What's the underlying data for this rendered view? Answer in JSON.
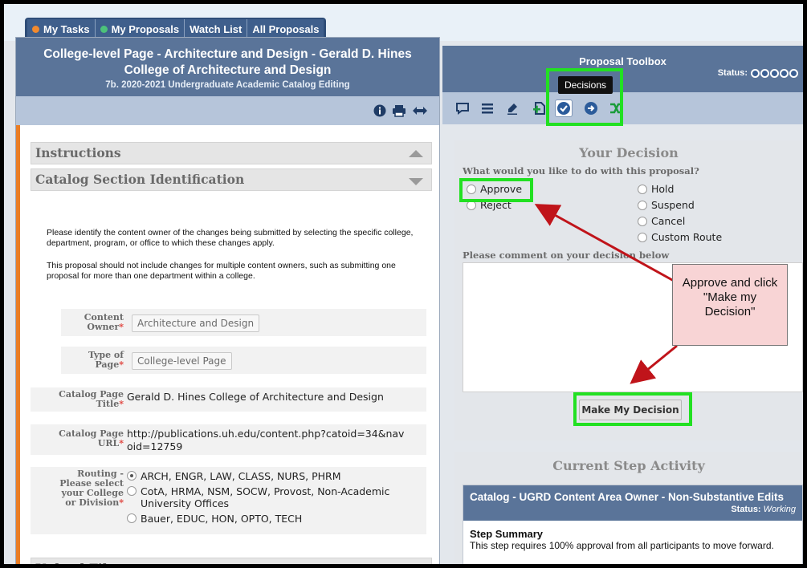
{
  "tabs": [
    {
      "label": "My Tasks",
      "dot_color": "#f28a2e"
    },
    {
      "label": "My Proposals",
      "dot_color": "#4cc17a"
    },
    {
      "label": "Watch List"
    },
    {
      "label": "All Proposals"
    }
  ],
  "proposal": {
    "title": "College-level Page - Architecture and Design - Gerald D. Hines College of Architecture and Design",
    "subtitle": "7b. 2020-2021 Undergraduate Academic Catalog Editing",
    "header_icons": [
      "info-icon",
      "print-icon",
      "expand-horizontal-icon"
    ]
  },
  "sections": {
    "instructions": "Instructions",
    "catalog_section": "Catalog Section Identification",
    "upload_file": "Upload File"
  },
  "instructions_text": {
    "p1": "Please identify the content owner of the changes being submitted by selecting the specific college, department, program, or office to which these changes apply.",
    "p2": "This proposal should not include changes for multiple content owners, such as submitting one proposal for more than one department within a college."
  },
  "fields": {
    "content_owner": {
      "label1": "Content",
      "label2": "Owner",
      "value": "Architecture and Design"
    },
    "type_of_page": {
      "label1": "Type of",
      "label2": "Page",
      "value": "College-level Page"
    },
    "page_title": {
      "label1": "Catalog Page",
      "label2": "Title",
      "value": "Gerald D. Hines College of Architecture and Design"
    },
    "page_url": {
      "label1": "Catalog Page",
      "label2": "URL",
      "value": "http://publications.uh.edu/content.php?catoid=34&navoid=12759"
    },
    "routing": {
      "label1": "Routing -",
      "label2": "Please select",
      "label3": "your College",
      "label4": "or Division",
      "options": [
        {
          "label": "ARCH, ENGR, LAW, CLASS, NURS, PHRM",
          "selected": true
        },
        {
          "label": "CotA, HRMA, NSM, SOCW, Provost, Non-Academic University Offices",
          "selected": false
        },
        {
          "label": "Bauer, EDUC, HON, OPTO, TECH",
          "selected": false
        }
      ]
    }
  },
  "toolbox": {
    "title": "Proposal Toolbox",
    "status_label": "Status:",
    "tooltip": "Decisions",
    "icons": [
      "comment-icon",
      "list-icon",
      "edit-pencil-icon",
      "add-document-icon",
      "decisions-check-icon",
      "reroute-icon",
      "shuffle-icon"
    ]
  },
  "decision": {
    "title": "Your Decision",
    "question": "What would you like to do with this proposal?",
    "options_left": [
      "Approve",
      "Reject"
    ],
    "options_right": [
      "Hold",
      "Suspend",
      "Cancel",
      "Custom Route"
    ],
    "comment_label": "Please comment on your decision below",
    "button": "Make My Decision"
  },
  "callout": {
    "line1": "Approve and click",
    "line2": "\"Make my",
    "line3": "Decision\""
  },
  "current_step": {
    "title": "Current Step Activity",
    "step_name": "Catalog - UGRD Content Area Owner - Non-Substantive Edits",
    "status_label": "Status:",
    "status_value": "Working",
    "summary_title": "Step Summary",
    "summary_text": "This step requires 100% approval from all participants to move forward."
  },
  "colors": {
    "header_blue": "#5a7499",
    "toolbar_blue": "#b6c5da",
    "highlight_green": "#22e022",
    "accent_orange": "#ea7d24",
    "arrow_red": "#c0141a",
    "callout_pink": "#f8d4d5"
  }
}
